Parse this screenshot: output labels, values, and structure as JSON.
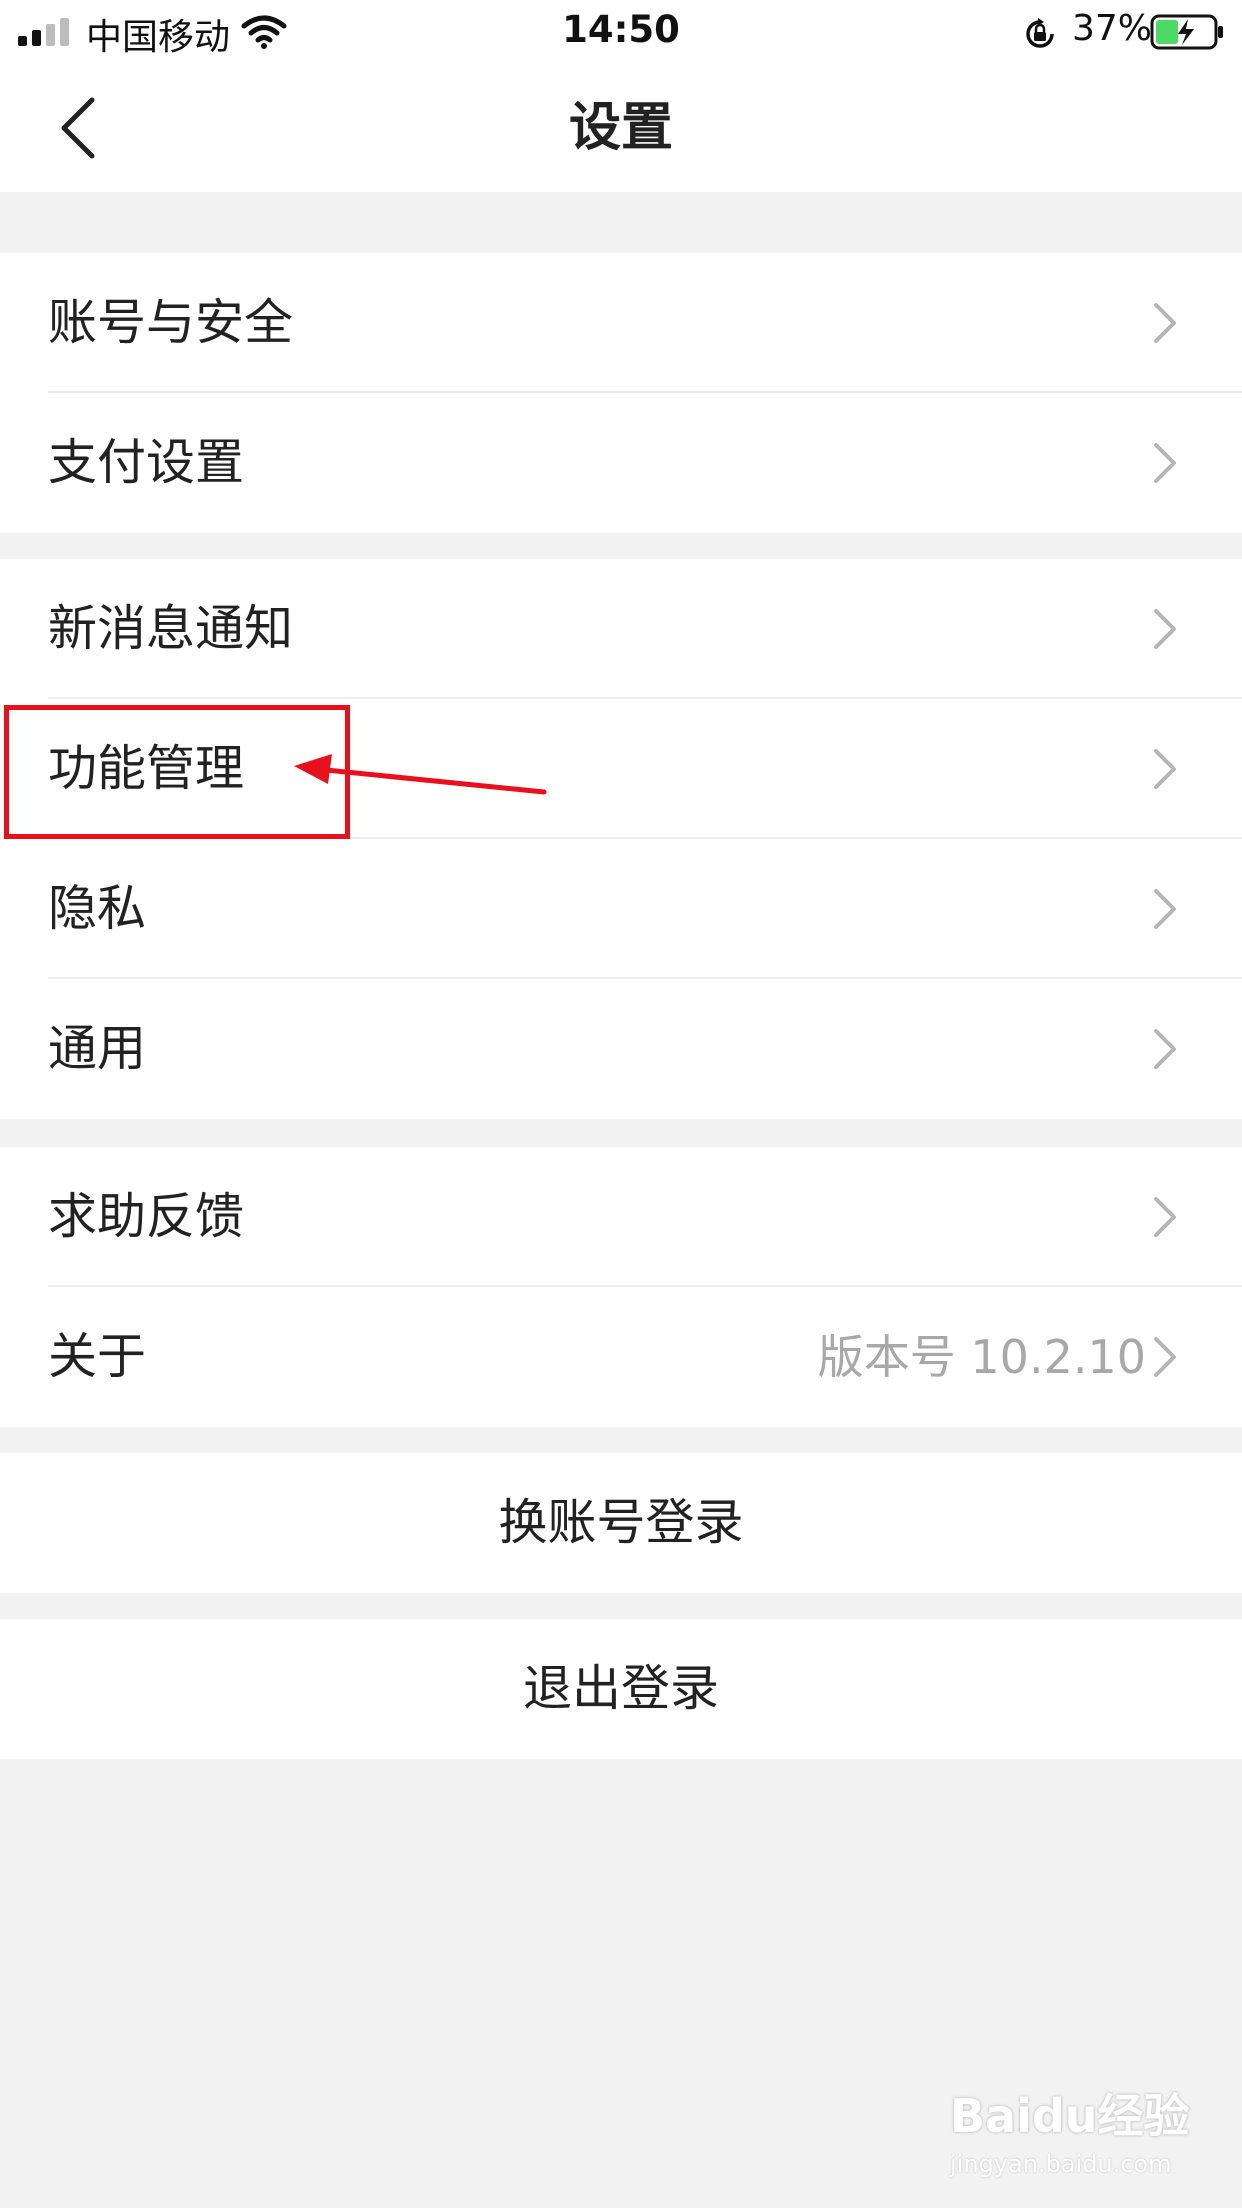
{
  "status_bar": {
    "carrier": "中国移动",
    "time": "14:50",
    "battery": "37%",
    "icons": [
      "signal-icon",
      "wifi-icon",
      "rotation-lock-icon",
      "battery-charging-icon"
    ]
  },
  "nav": {
    "title": "设置",
    "back_icon": "chevron-left-icon"
  },
  "groups": [
    {
      "items": [
        {
          "label": "账号与安全"
        },
        {
          "label": "支付设置"
        }
      ]
    },
    {
      "items": [
        {
          "label": "新消息通知"
        },
        {
          "label": "功能管理"
        },
        {
          "label": "隐私"
        },
        {
          "label": "通用"
        }
      ]
    },
    {
      "items": [
        {
          "label": "求助反馈"
        },
        {
          "label": "关于",
          "value": "版本号 10.2.10"
        }
      ]
    }
  ],
  "actions": {
    "switch_account": "换账号登录",
    "logout": "退出登录"
  },
  "annotation": {
    "highlight_color": "#e8101c",
    "target": "功能管理"
  },
  "watermark": {
    "logo": "Baidu经验",
    "url": "jingyan.baidu.com"
  },
  "colors": {
    "background": "#f2f2f2",
    "row": "#ffffff",
    "text": "#222222",
    "secondary": "#a8a8a8",
    "chevron": "#b5b5b5"
  }
}
